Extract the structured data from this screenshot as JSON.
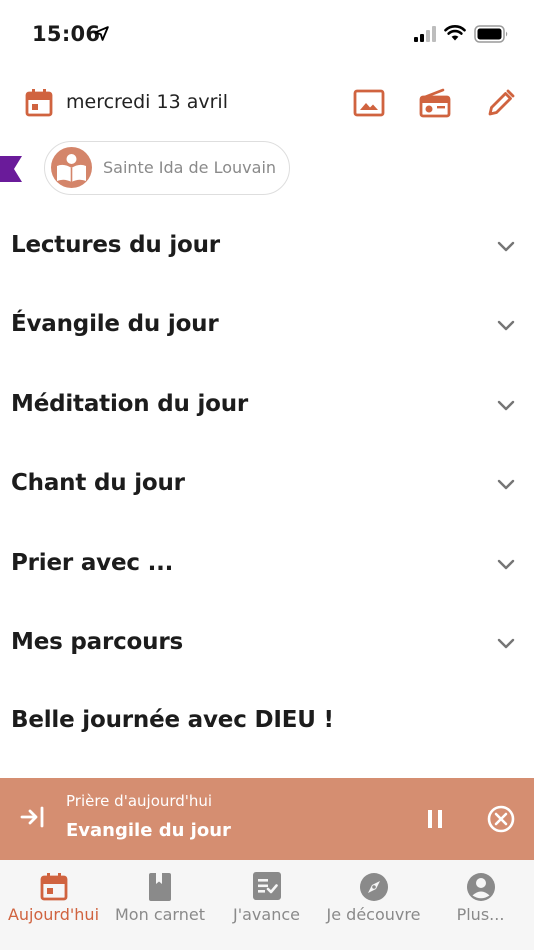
{
  "status_bar": {
    "time": "15:06"
  },
  "header": {
    "date": "mercredi 13 avril"
  },
  "saint": {
    "name": "Sainte Ida de Louvain"
  },
  "sections": [
    {
      "label": "Lectures du jour"
    },
    {
      "label": "Évangile du jour"
    },
    {
      "label": "Méditation du jour"
    },
    {
      "label": "Chant du jour"
    },
    {
      "label": "Prier avec ..."
    },
    {
      "label": "Mes parcours"
    }
  ],
  "closing": "Belle journée avec DIEU !",
  "player": {
    "subtitle": "Prière d'aujourd'hui",
    "title": "Evangile du jour"
  },
  "tabs": [
    {
      "label": "Aujourd'hui",
      "icon": "calendar-icon",
      "active": true
    },
    {
      "label": "Mon carnet",
      "icon": "book-icon",
      "active": false
    },
    {
      "label": "J'avance",
      "icon": "checklist-icon",
      "active": false
    },
    {
      "label": "Je découvre",
      "icon": "compass-icon",
      "active": false
    },
    {
      "label": "Plus...",
      "icon": "account-icon",
      "active": false
    }
  ],
  "colors": {
    "accent": "#d0633f",
    "player_bg": "#d58e71",
    "ribbon": "#6a1b9a",
    "inactive": "#8a8a8a"
  }
}
